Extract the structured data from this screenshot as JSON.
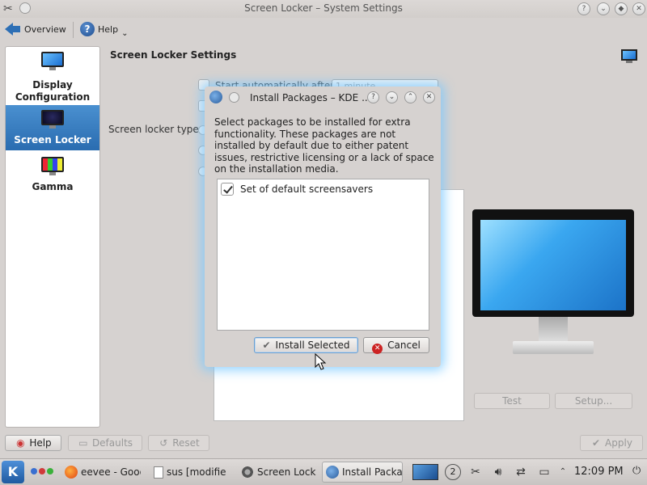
{
  "window": {
    "title": "Screen Locker – System Settings"
  },
  "toolbar": {
    "overview_label": "Overview",
    "help_label": "Help"
  },
  "sidebar": {
    "items": [
      {
        "label": "Display Configuration",
        "selected": false,
        "icon": "display-icon"
      },
      {
        "label": "Screen Locker",
        "selected": true,
        "icon": "screen-locker-icon"
      },
      {
        "label": "Gamma",
        "selected": false,
        "icon": "gamma-icon"
      }
    ]
  },
  "content": {
    "title": "Screen Locker Settings",
    "start_auto_label": "Start automatically after:",
    "start_auto_value": "1 minute",
    "locker_type_label": "Screen locker type:",
    "test_label": "Test",
    "setup_label": "Setup..."
  },
  "footer": {
    "help_label": "Help",
    "defaults_label": "Defaults",
    "reset_label": "Reset",
    "apply_label": "Apply"
  },
  "dialog": {
    "title": "Install Packages – KDE ...",
    "description": "Select packages to be installed for extra functionality. These packages are not installed by default due to either patent issues, restrictive licensing or a lack of space on the installation media.",
    "packages": [
      {
        "label": "Set of default screensavers",
        "checked": true
      }
    ],
    "install_label": "Install Selected",
    "cancel_label": "Cancel"
  },
  "taskbar": {
    "tasks": [
      {
        "label": "eevee - Goog",
        "icon": "firefox-icon",
        "active": false
      },
      {
        "label": "sus [modifie",
        "icon": "document-icon",
        "active": false
      },
      {
        "label": "Screen Lock",
        "icon": "settings-icon",
        "active": false
      },
      {
        "label": "Install Packa",
        "icon": "package-icon",
        "active": true
      }
    ],
    "desktop_number": "2",
    "clock": "12:09 PM"
  },
  "colors": {
    "accent": "#2a6cb0",
    "dialog_glow": "#78c8ff",
    "cancel_red": "#cc2222"
  }
}
